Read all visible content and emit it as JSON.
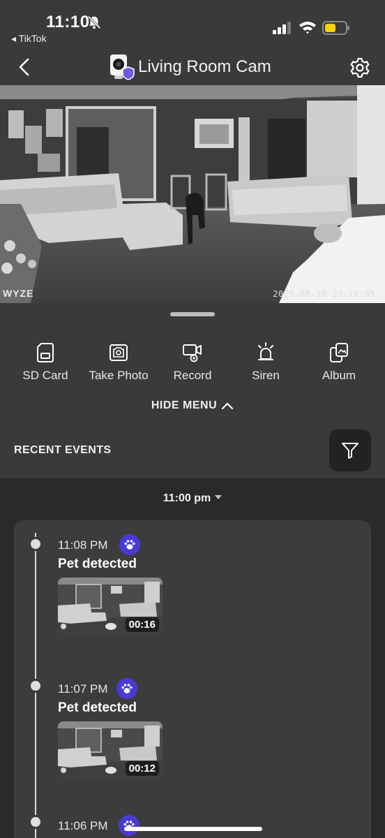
{
  "status_bar": {
    "time": "11:10",
    "back_app": "◂ TikTok",
    "battery_color": "#f5d20a"
  },
  "nav": {
    "title": "Living Room Cam"
  },
  "feed": {
    "timestamp": "2025-08-30 23:10:05",
    "watermark": "WYZE"
  },
  "menu": {
    "items": [
      {
        "label": "SD Card",
        "icon": "sd-card-icon"
      },
      {
        "label": "Take Photo",
        "icon": "camera-icon"
      },
      {
        "label": "Record",
        "icon": "record-icon"
      },
      {
        "label": "Siren",
        "icon": "siren-icon"
      },
      {
        "label": "Album",
        "icon": "album-icon"
      }
    ],
    "hide_label": "HIDE MENU"
  },
  "recent_events": {
    "title": "RECENT EVENTS",
    "time_filter": "11:00 pm",
    "events": [
      {
        "time": "11:08 PM",
        "title": "Pet detected",
        "duration": "00:16",
        "badge_icon": "paw-icon"
      },
      {
        "time": "11:07 PM",
        "title": "Pet detected",
        "duration": "00:12",
        "badge_icon": "paw-icon"
      },
      {
        "time": "11:06 PM",
        "badge_icon": "paw-icon"
      }
    ]
  },
  "colors": {
    "background": "#3a3a3a",
    "events_background": "#2a2a2a",
    "card": "#3c3c3c",
    "accent_badge": "#4b39d6"
  }
}
